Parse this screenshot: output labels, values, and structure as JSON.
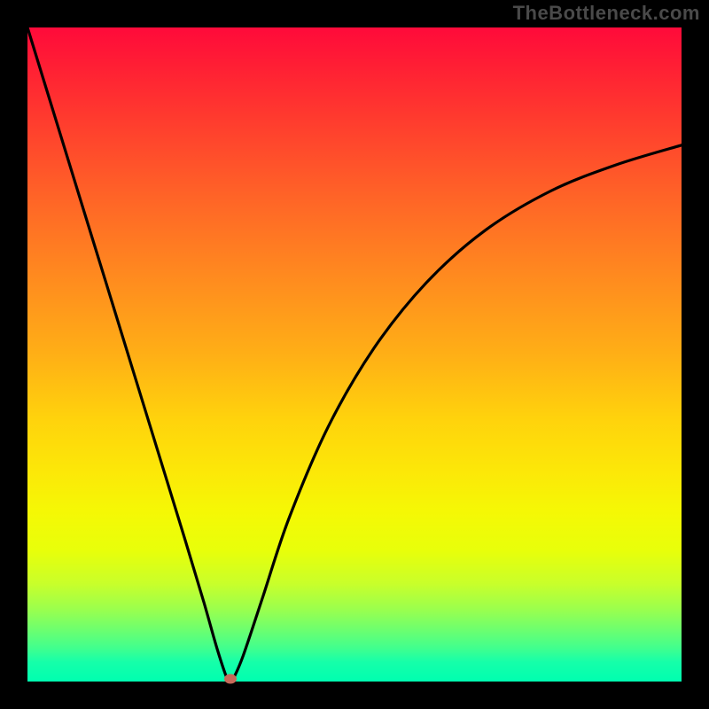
{
  "watermark": "TheBottleneck.com",
  "chart_data": {
    "type": "line",
    "title": "",
    "xlabel": "",
    "ylabel": "",
    "xlim": [
      0,
      1
    ],
    "ylim": [
      0,
      1
    ],
    "description": "Bottleneck / mismatch curve. X axis is a normalized component ratio, Y axis is normalized bottleneck severity. Minimum near x≈0.31. Background gradient encodes severity: green (bottom, low) → yellow → orange → red (top, high).",
    "series": [
      {
        "name": "bottleneck-curve",
        "x": [
          0.0,
          0.04,
          0.08,
          0.12,
          0.16,
          0.2,
          0.24,
          0.27,
          0.29,
          0.305,
          0.31,
          0.315,
          0.33,
          0.36,
          0.4,
          0.46,
          0.53,
          0.61,
          0.7,
          0.8,
          0.9,
          1.0
        ],
        "values": [
          1.0,
          0.87,
          0.74,
          0.61,
          0.48,
          0.35,
          0.22,
          0.12,
          0.05,
          0.005,
          0.0,
          0.005,
          0.04,
          0.13,
          0.25,
          0.39,
          0.51,
          0.61,
          0.69,
          0.75,
          0.79,
          0.82
        ]
      }
    ],
    "marker": {
      "x": 0.31,
      "y": 0.0,
      "color": "#c66a5a"
    },
    "gradient_stops": [
      {
        "pos": 0.0,
        "color": "#ff0a3a"
      },
      {
        "pos": 0.5,
        "color": "#ffaf16"
      },
      {
        "pos": 0.74,
        "color": "#f5f805"
      },
      {
        "pos": 1.0,
        "color": "#00ffb0"
      }
    ]
  },
  "layout": {
    "image_size": 800,
    "border": 31,
    "plot_size": 738
  }
}
